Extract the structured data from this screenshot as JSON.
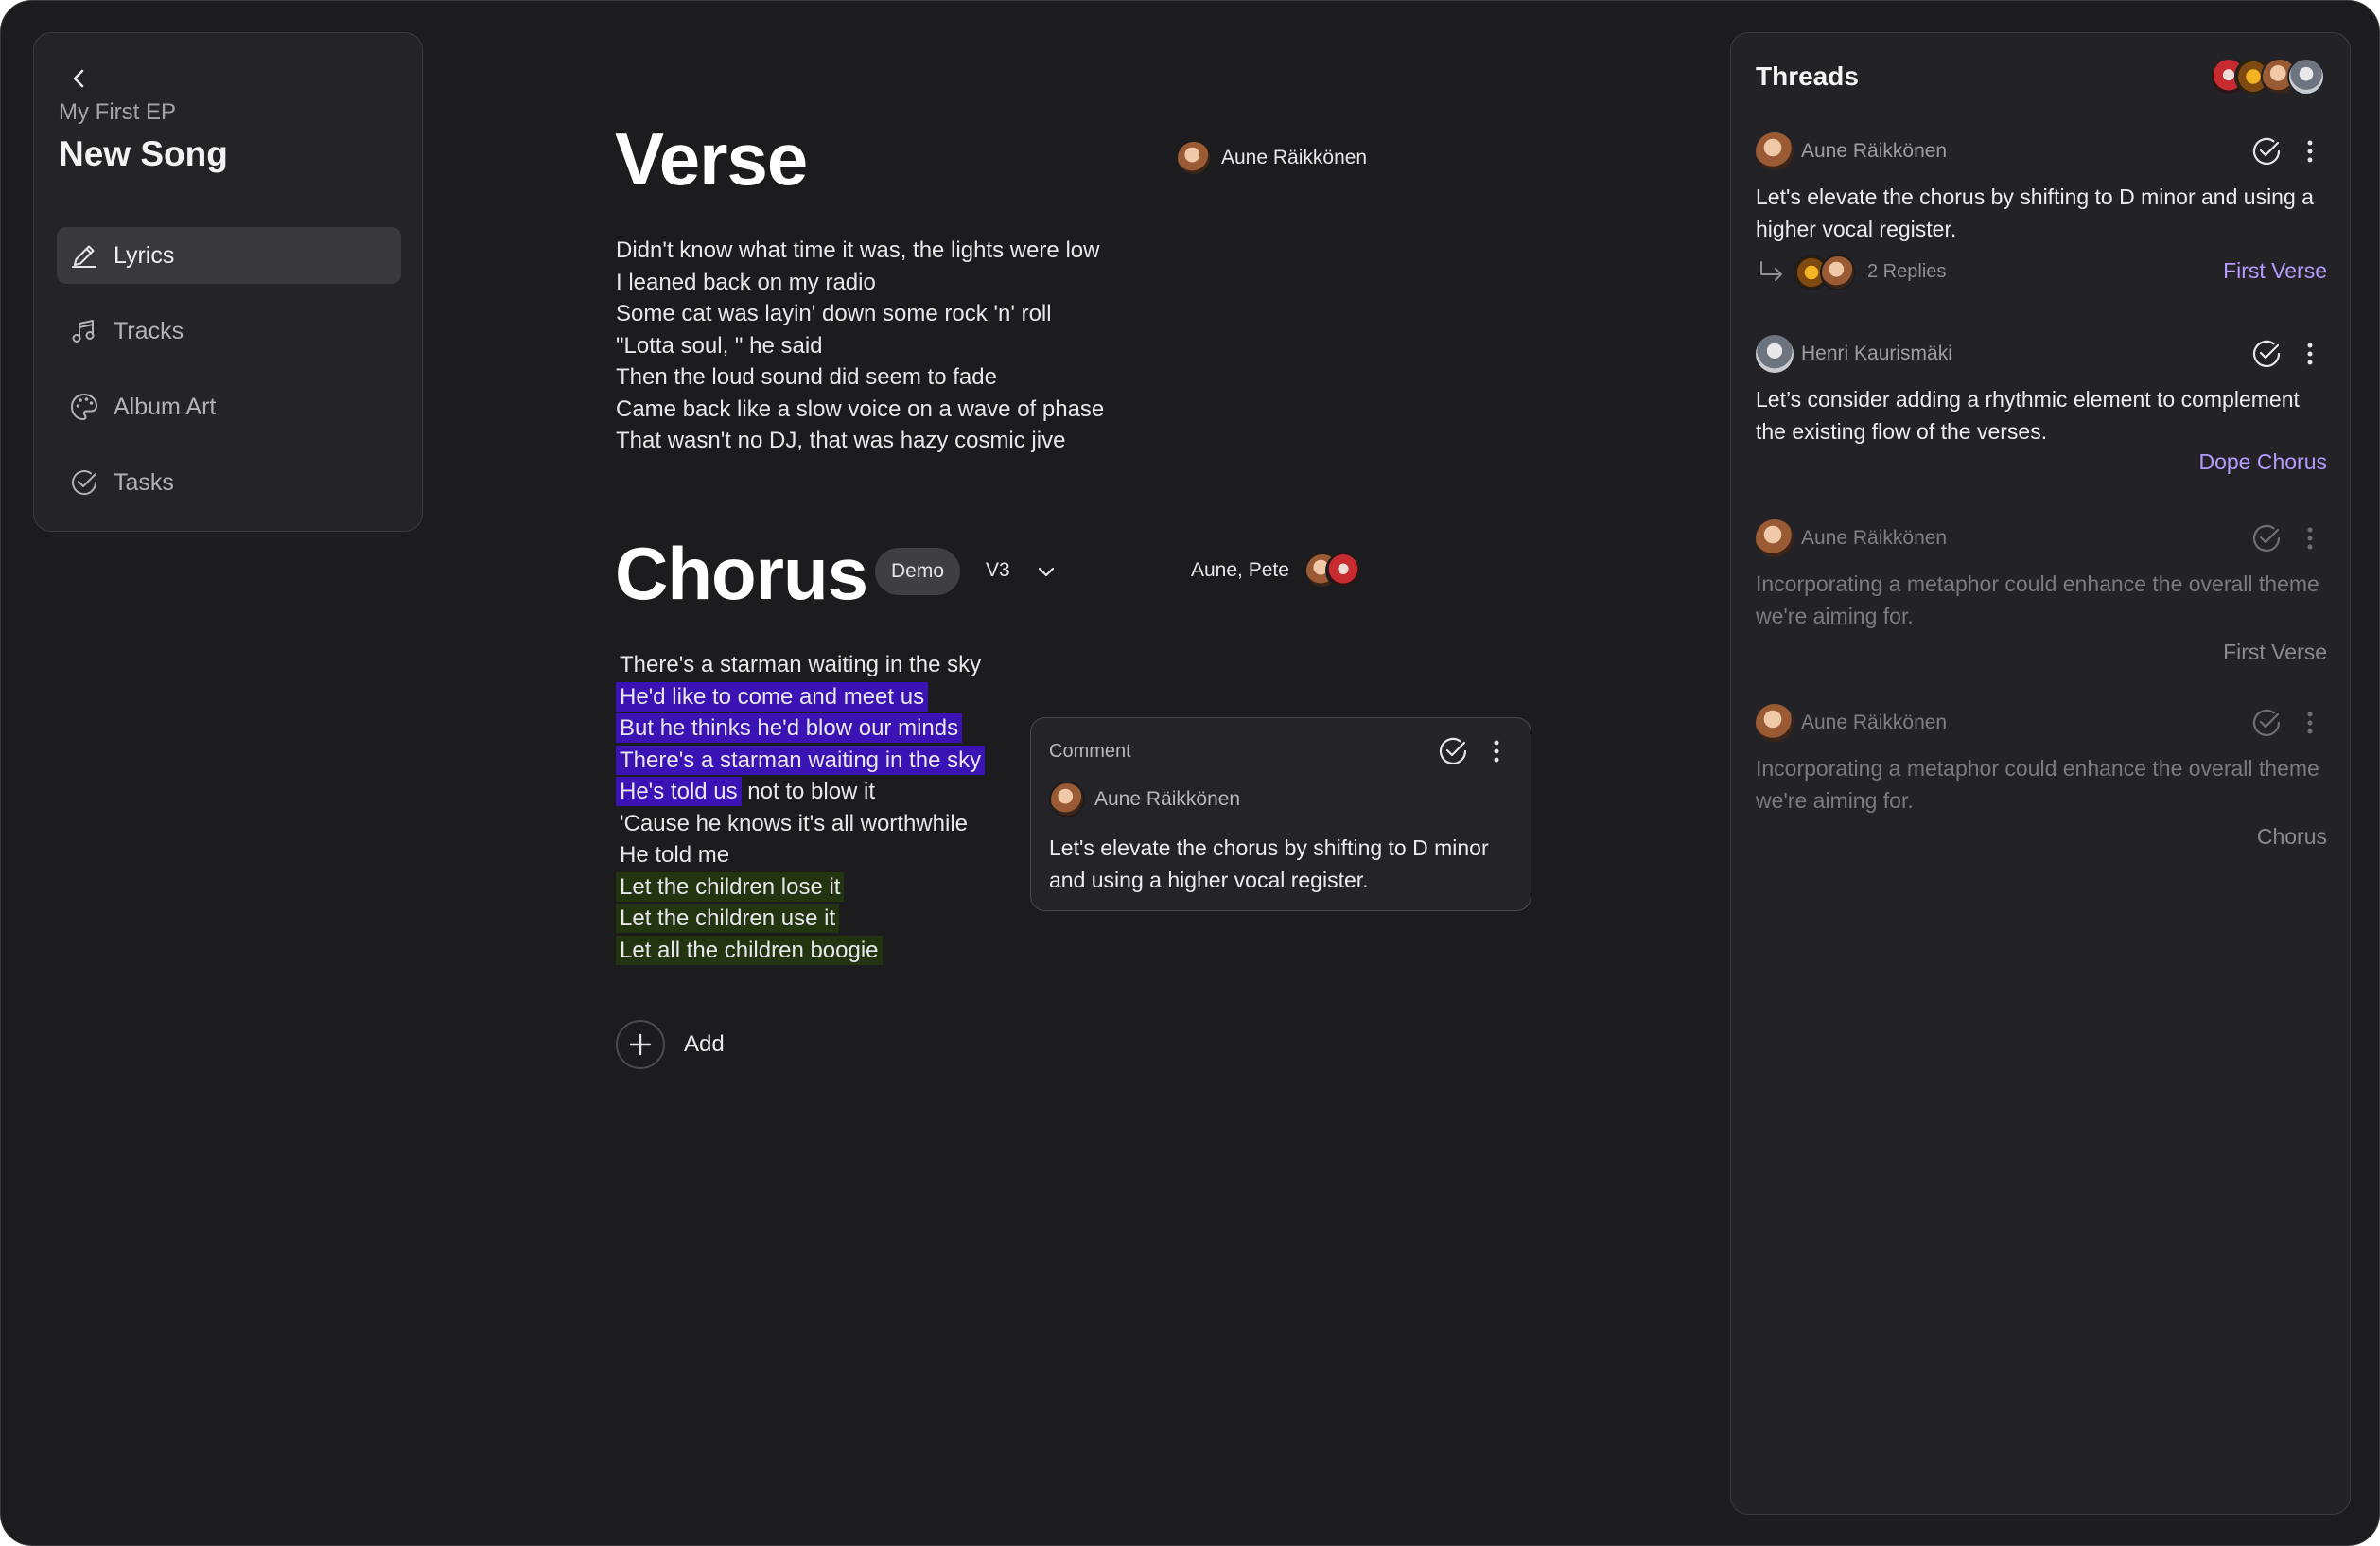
{
  "sidebar": {
    "project_name": "My First EP",
    "song_title": "New Song",
    "items": [
      {
        "label": "Lyrics",
        "icon": "pencil-icon",
        "active": true
      },
      {
        "label": "Tracks",
        "icon": "music-note-icon",
        "active": false
      },
      {
        "label": "Album Art",
        "icon": "palette-icon",
        "active": false
      },
      {
        "label": "Tasks",
        "icon": "check-circle-icon",
        "active": false
      }
    ]
  },
  "verse": {
    "title": "Verse",
    "author": "Aune Räikkönen",
    "lines": [
      "Didn't know what time it was, the lights were low",
      "I leaned back on my radio",
      "Some cat was layin' down some rock 'n' roll",
      "\"Lotta soul, \" he said",
      "Then the loud sound did seem to fade",
      "Came back like a slow voice on a wave of phase",
      "That wasn't no DJ, that was hazy cosmic jive"
    ]
  },
  "chorus": {
    "title": "Chorus",
    "badge": "Demo",
    "version": "V3",
    "authors": "Aune, Pete",
    "lines": [
      {
        "text": "There's a starman waiting in the sky",
        "rest": "",
        "highlight": "none"
      },
      {
        "text": "He'd like to come and meet us",
        "rest": "",
        "highlight": "purple"
      },
      {
        "text": "But he thinks he'd blow our minds",
        "rest": "",
        "highlight": "purple"
      },
      {
        "text": "There's a starman waiting in the sky",
        "rest": "",
        "highlight": "purple"
      },
      {
        "text": "He's told us",
        "rest": " not to blow it",
        "highlight": "purple"
      },
      {
        "text": "'Cause he knows it's all worthwhile",
        "rest": "",
        "highlight": "none"
      },
      {
        "text": "He told me",
        "rest": "",
        "highlight": "none"
      },
      {
        "text": "Let the children lose it",
        "rest": "",
        "highlight": "green"
      },
      {
        "text": "Let the children use it",
        "rest": "",
        "highlight": "green"
      },
      {
        "text": "Let all the children boogie",
        "rest": "",
        "highlight": "green"
      }
    ]
  },
  "comment_popup": {
    "label": "Comment",
    "author": "Aune Räikkönen",
    "body": "Let's elevate the chorus by shifting to D minor and using a higher vocal register."
  },
  "add": {
    "label": "Add"
  },
  "threads": {
    "title": "Threads",
    "items": [
      {
        "author": "Aune Räikkönen",
        "text": "Let's elevate the chorus by shifting to D minor and using a higher vocal register.",
        "replies": "2 Replies",
        "tag": "First Verse",
        "dim": false
      },
      {
        "author": "Henri Kaurismäki",
        "text": "Let’s consider adding a rhythmic element to complement the existing flow of the verses.",
        "tag": "Dope Chorus",
        "dim": false
      },
      {
        "author": "Aune Räikkönen",
        "text": "Incorporating a metaphor could enhance the overall theme we're aiming for.",
        "tag": "First Verse",
        "dim": true
      },
      {
        "author": "Aune Räikkönen",
        "text": "Incorporating a metaphor could enhance the overall theme we're aiming for.",
        "tag": "Chorus",
        "dim": true
      }
    ]
  },
  "colors": {
    "background": "#1c1c1f",
    "panel": "#242428",
    "highlight_purple": "#3b12b3",
    "highlight_green": "#233411",
    "link": "#b49cff"
  }
}
